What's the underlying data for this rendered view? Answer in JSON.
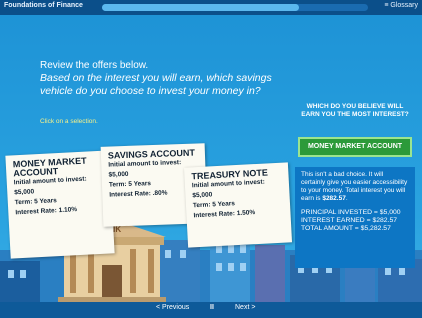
{
  "header": {
    "title": "Foundations of Finance",
    "progress_fraction": 0.74,
    "glossary_label": "≡ Glossary"
  },
  "main": {
    "intro": "Review the offers below.",
    "question": "Based on the interest you will earn, which savings vehicle do you choose to invest your money in?",
    "instruction": "Click on a selection."
  },
  "offers": [
    {
      "name": "MONEY MARKET ACCOUNT",
      "initial": "Initial amount to invest: $5,000",
      "term": "Term: 5 Years",
      "rate": "Interest Rate: 1.10%"
    },
    {
      "name": "SAVINGS ACCOUNT",
      "initial": "Initial amount to invest: $5,000",
      "term": "Term: 5 Years",
      "rate": "Interest Rate: .80%"
    },
    {
      "name": "TREASURY NOTE",
      "initial": "Initial amount to invest: $5,000",
      "term": "Term: 5 Years",
      "rate": "Interest Rate: 1.50%"
    }
  ],
  "right_panel": {
    "question": "WHICH DO YOU BELIEVE WILL EARN YOU THE MOST INTEREST?",
    "selected": "MONEY MARKET ACCOUNT",
    "feedback": "This isn't a bad choice. It will certainly give you easier accessibility to your money. Total interest you will earn is",
    "feedback_amount": "$282.57",
    "feedback_end": ".",
    "principal": "PRINCIPAL INVESTED = $5,000",
    "interest": "INTEREST EARNED = $282.57",
    "total": "TOTAL AMOUNT = $5,282.57"
  },
  "scene": {
    "bank_label": "BANK"
  },
  "nav": {
    "prev_label": "< Previous",
    "pause_label": "II",
    "next_label": "Next    >"
  },
  "colors": {
    "background": "#1b8bd0",
    "topbar": "#0b4f8a",
    "button_green": "#2c9a3a",
    "card": "#fbfaf2"
  }
}
